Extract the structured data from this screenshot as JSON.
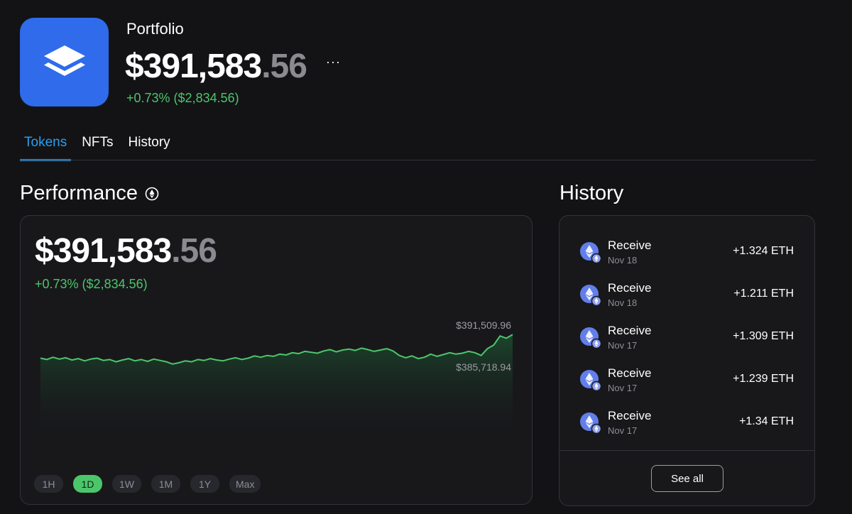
{
  "header": {
    "title": "Portfolio",
    "value_main": "$391,583",
    "value_cents": ".56",
    "more_label": "···",
    "change": "+0.73% ($2,834.56)"
  },
  "tabs": [
    {
      "label": "Tokens",
      "active": true
    },
    {
      "label": "NFTs",
      "active": false
    },
    {
      "label": "History",
      "active": false
    }
  ],
  "performance": {
    "title": "Performance",
    "value_main": "$391,583",
    "value_cents": ".56",
    "change": "+0.73% ($2,834.56)",
    "label_high": "$391,509.96",
    "label_low": "$385,718.94",
    "ranges": [
      {
        "label": "1H",
        "active": false
      },
      {
        "label": "1D",
        "active": true
      },
      {
        "label": "1W",
        "active": false
      },
      {
        "label": "1M",
        "active": false
      },
      {
        "label": "1Y",
        "active": false
      },
      {
        "label": "Max",
        "active": false
      }
    ]
  },
  "history": {
    "title": "History",
    "items": [
      {
        "type": "Receive",
        "date": "Nov 18",
        "amount": "+1.324 ETH"
      },
      {
        "type": "Receive",
        "date": "Nov 18",
        "amount": "+1.211 ETH"
      },
      {
        "type": "Receive",
        "date": "Nov 17",
        "amount": "+1.309 ETH"
      },
      {
        "type": "Receive",
        "date": "Nov 17",
        "amount": "+1.239 ETH"
      },
      {
        "type": "Receive",
        "date": "Nov 17",
        "amount": "+1.34 ETH"
      }
    ],
    "see_all_label": "See all"
  },
  "icons": {
    "logo": "stacked-layers-icon",
    "network": "ethereum-icon",
    "more": "more-dots-icon"
  },
  "colors": {
    "accent": "#2d9df0",
    "positive": "#4cc66a",
    "logo_bg": "#2f6bea",
    "eth": "#627eea"
  },
  "chart_data": {
    "type": "area",
    "title": "",
    "xlabel": "",
    "ylabel": "",
    "range": "1D",
    "max_label": 391509.96,
    "min_label": 385718.94,
    "series": [
      {
        "values": [
          388600,
          388450,
          388700,
          388500,
          388650,
          388400,
          388550,
          388300,
          388500,
          388600,
          388350,
          388450,
          388200,
          388400,
          388550,
          388300,
          388450,
          388250,
          388500,
          388350,
          388200,
          387950,
          388100,
          388300,
          388200,
          388450,
          388350,
          388550,
          388400,
          388300,
          388500,
          388650,
          388450,
          388600,
          388850,
          388700,
          388900,
          388800,
          389050,
          388950,
          389200,
          389100,
          389350,
          389250,
          389150,
          389400,
          389550,
          389300,
          389500,
          389600,
          389450,
          389700,
          389550,
          389350,
          389500,
          389650,
          389400,
          388900,
          388650,
          388850,
          388550,
          388700,
          389050,
          388800,
          389000,
          389200,
          389050,
          389150,
          389350,
          389200,
          388900,
          389650,
          390050,
          391050,
          390800,
          391200
        ]
      }
    ]
  }
}
